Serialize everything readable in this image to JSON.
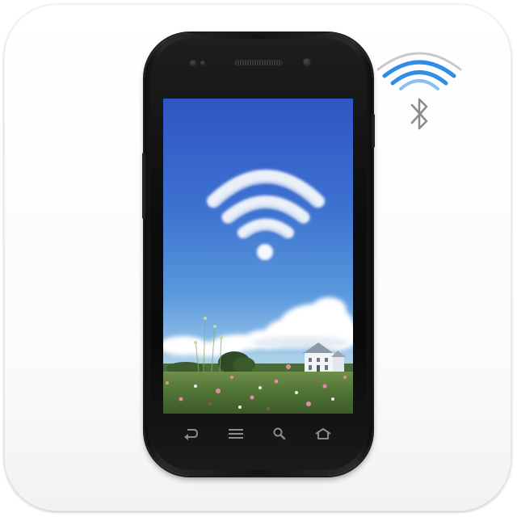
{
  "tile": {
    "name": "app-icon-tile"
  },
  "phone": {
    "screen": {
      "wallpaper": "wifi-cloud-meadow-wallpaper",
      "sky_colors": [
        "#2f55c4",
        "#5a98dc",
        "#a9cfe9"
      ],
      "cloud_wifi_bars": 3
    },
    "nav_buttons": [
      {
        "name": "back-button",
        "icon": "back-arrow-icon"
      },
      {
        "name": "menu-button",
        "icon": "menu-lines-icon"
      },
      {
        "name": "search-button",
        "icon": "search-icon"
      },
      {
        "name": "home-button",
        "icon": "home-icon"
      }
    ]
  },
  "badge": {
    "wifi_icon": "wifi-icon",
    "bluetooth_icon": "bluetooth-icon",
    "wifi_color": "#2f8de8",
    "wifi_inactive_color": "#c8c8c8",
    "bluetooth_color": "#8a8a8a"
  }
}
